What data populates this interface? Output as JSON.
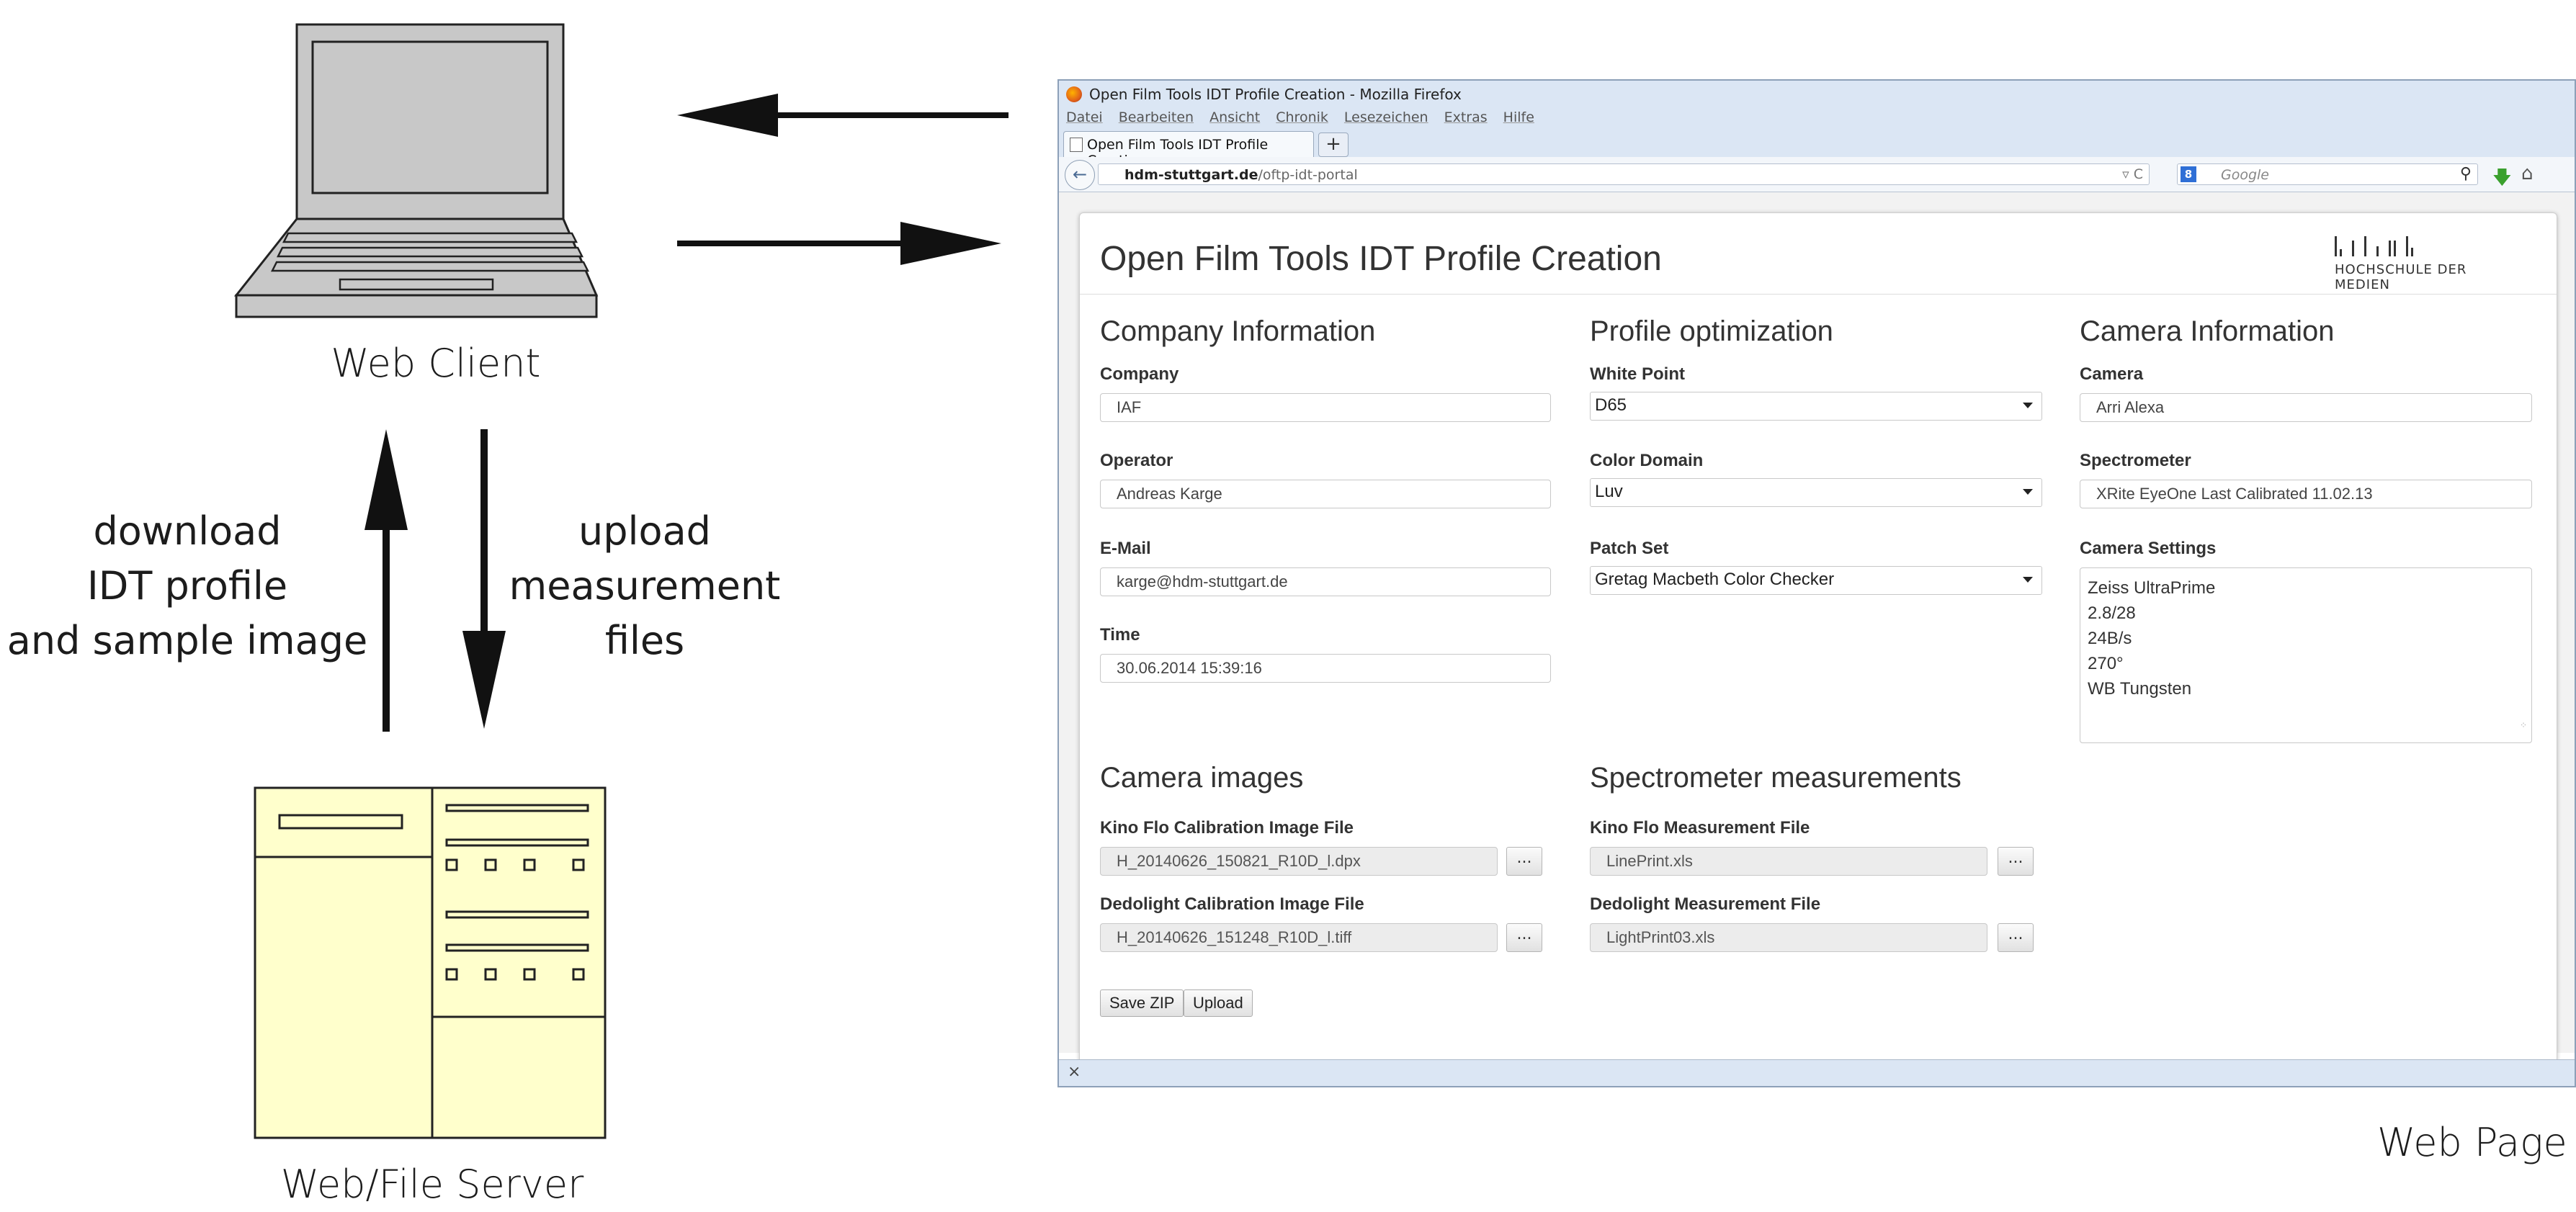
{
  "diagram": {
    "client_label": "Web Client",
    "server_label": "Web/File Server",
    "page_label": "Web Page",
    "download_label": [
      "download",
      "IDT profile",
      "and sample image"
    ],
    "upload_label": [
      "upload",
      "measurement",
      "files"
    ]
  },
  "browser": {
    "window_title": "Open Film Tools IDT Profile Creation - Mozilla Firefox",
    "menu": [
      "Datei",
      "Bearbeiten",
      "Ansicht",
      "Chronik",
      "Lesezeichen",
      "Extras",
      "Hilfe"
    ],
    "tab_title": "Open Film Tools IDT Profile Creation",
    "url_domain": "hdm-stuttgart.de",
    "url_path": "/oftp-idt-portal",
    "search_placeholder": "Google",
    "status_close": "×"
  },
  "page": {
    "title": "Open Film Tools IDT Profile Creation",
    "logo_text": "HOCHSCHULE DER MEDIEN",
    "company_section": {
      "heading": "Company Information",
      "company_label": "Company",
      "company_value": "IAF",
      "operator_label": "Operator",
      "operator_value": "Andreas Karge",
      "email_label": "E-Mail",
      "email_value": "karge@hdm-stuttgart.de",
      "time_label": "Time",
      "time_value": "30.06.2014 15:39:16"
    },
    "profile_section": {
      "heading": "Profile optimization",
      "white_point_label": "White Point",
      "white_point_value": "D65",
      "color_domain_label": "Color Domain",
      "color_domain_value": "Luv",
      "patch_set_label": "Patch Set",
      "patch_set_value": "Gretag Macbeth Color Checker"
    },
    "camera_section": {
      "heading": "Camera Information",
      "camera_label": "Camera",
      "camera_value": "Arri Alexa",
      "spectrometer_label": "Spectrometer",
      "spectrometer_value": "XRite EyeOne Last Calibrated 11.02.13",
      "settings_label": "Camera Settings",
      "settings_lines": [
        "Zeiss UltraPrime",
        "2.8/28",
        "24B/s",
        "270°",
        "WB Tungsten"
      ]
    },
    "images_section": {
      "heading": "Camera images",
      "kino_label": "Kino Flo Calibration Image File",
      "kino_value": "H_20140626_150821_R10D_l.dpx",
      "dedo_label": "Dedolight Calibration Image File",
      "dedo_value": "H_20140626_151248_R10D_l.tiff"
    },
    "spectro_section": {
      "heading": "Spectrometer measurements",
      "kino_label": "Kino Flo Measurement File",
      "kino_value": "LinePrint.xls",
      "dedo_label": "Dedolight Measurement File",
      "dedo_value": "LightPrint03.xls"
    },
    "browse_label": "...",
    "save_zip_label": "Save ZIP",
    "upload_label": "Upload"
  },
  "icons": {
    "laptop": "laptop-icon",
    "server": "server-icon",
    "back": "back-arrow-icon",
    "reload": "reload-icon",
    "search": "magnifier-icon",
    "download": "download-arrow-icon",
    "home": "home-icon"
  },
  "colors": {
    "laptop_gray": "#c8c8c8",
    "server_fill": "#ffffcc",
    "arrow": "#111111",
    "browser_chrome": "#dbe6f4"
  }
}
